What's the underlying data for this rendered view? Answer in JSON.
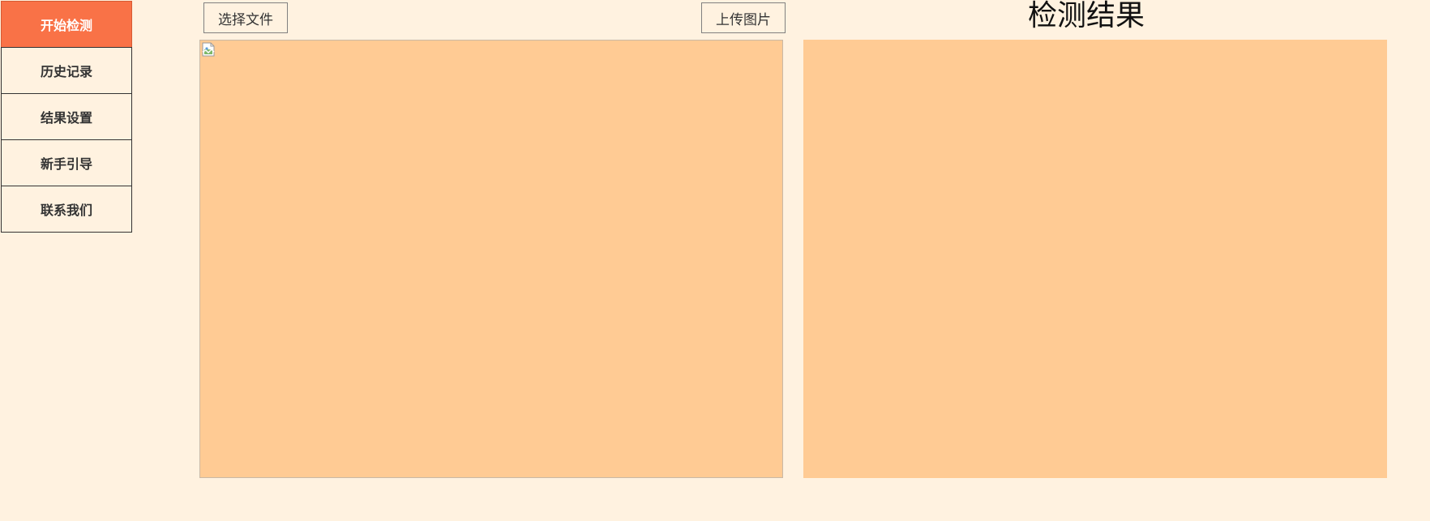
{
  "sidebar": {
    "items": [
      {
        "label": "开始检测",
        "active": true
      },
      {
        "label": "历史记录",
        "active": false
      },
      {
        "label": "结果设置",
        "active": false
      },
      {
        "label": "新手引导",
        "active": false
      },
      {
        "label": "联系我们",
        "active": false
      }
    ]
  },
  "toolbar": {
    "choose_file_label": "选择文件",
    "upload_label": "上传图片"
  },
  "result": {
    "title": "检测结果"
  },
  "colors": {
    "page_background": "#fff2e0",
    "active_nav": "#f97247",
    "panel_background": "#ffcb94"
  },
  "icons": {
    "preview_placeholder": "broken-image-icon"
  }
}
